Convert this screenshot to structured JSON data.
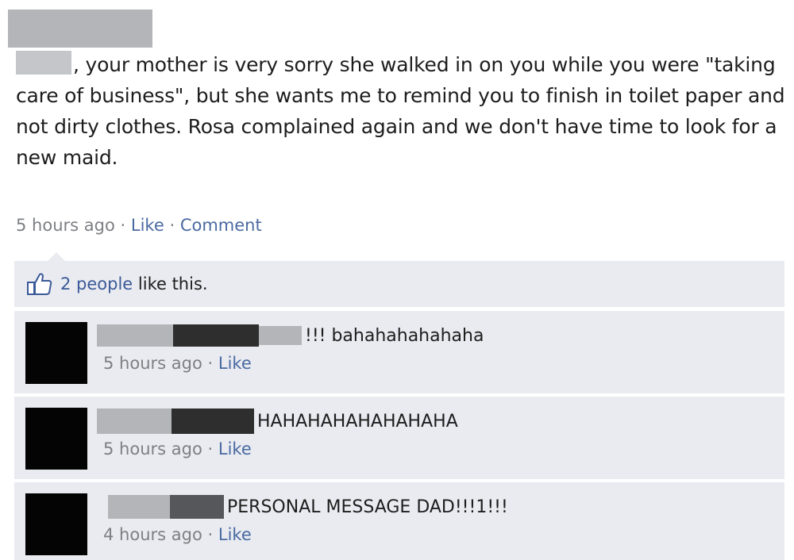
{
  "post": {
    "text": ", your mother is very sorry she walked in on you while you were \"taking care of business\", but she wants me to remind you to finish in toilet paper and not dirty clothes. Rosa complained again and we don't have time to look for a new maid.",
    "time": "5 hours ago",
    "sep": "·",
    "like": "Like",
    "comment": "Comment"
  },
  "likes": {
    "count": "2 people",
    "suffix": " like this."
  },
  "comments": [
    {
      "text": "!!! bahahahahahaha",
      "time": "5 hours ago",
      "like": "Like"
    },
    {
      "text": "HAHAHAHAHAHAHAHA",
      "time": "5 hours ago",
      "like": "Like"
    },
    {
      "text": "PERSONAL MESSAGE DAD!!!1!!!",
      "time": "4 hours ago",
      "like": "Like"
    }
  ],
  "colors": {
    "link": "#3b5998",
    "panel": "#e9ebf0",
    "meta": "#7d7f83"
  }
}
